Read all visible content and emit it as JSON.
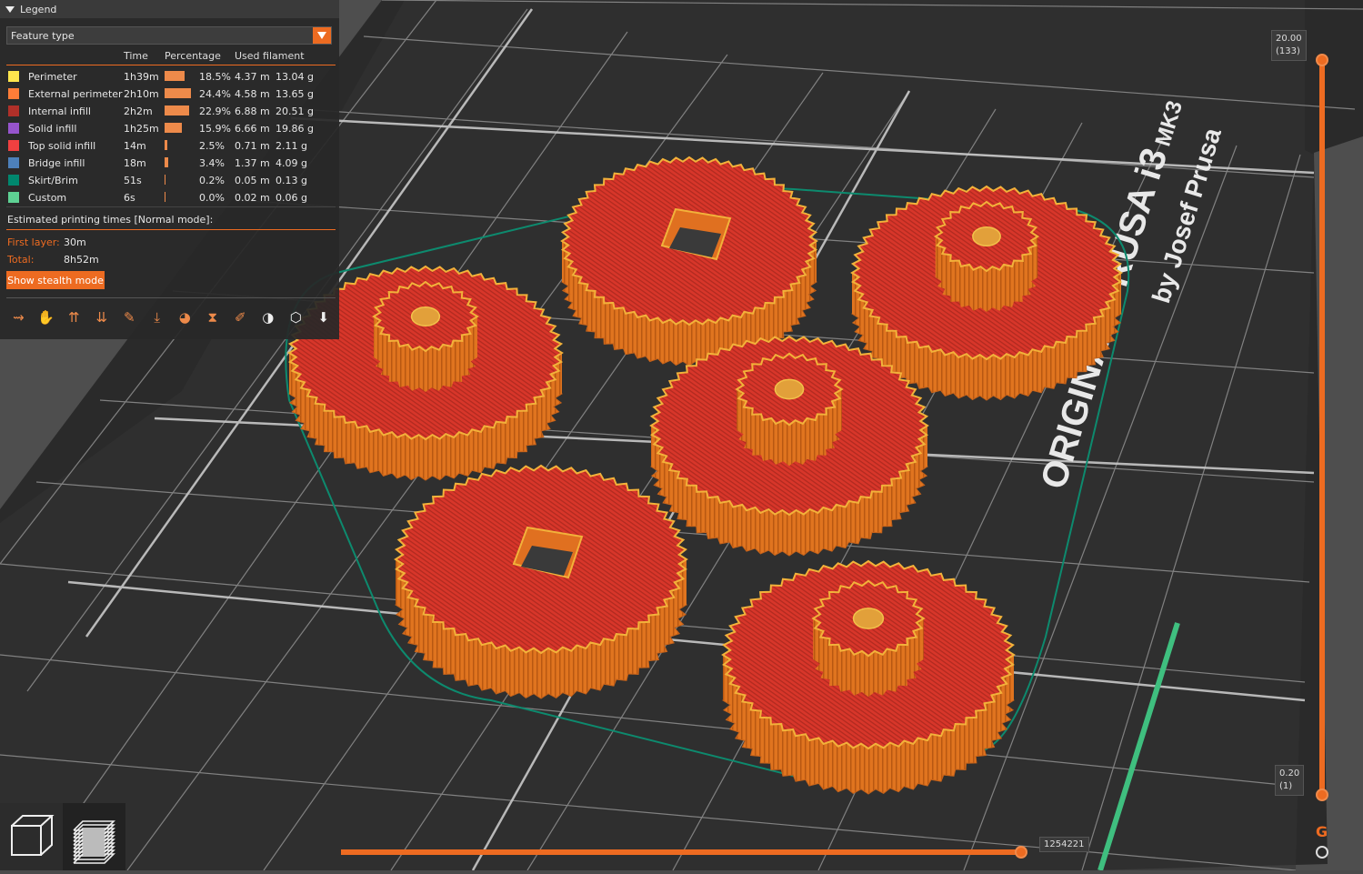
{
  "legend": {
    "title": "Legend",
    "view_type": "Feature type",
    "columns": {
      "time": "Time",
      "percentage": "Percentage",
      "filament": "Used filament"
    },
    "rows": [
      {
        "name": "Perimeter",
        "color": "#ffe64d",
        "time": "1h39m",
        "percent": "18.5%",
        "percent_value": 18.5,
        "length": "4.37 m",
        "weight": "13.04 g"
      },
      {
        "name": "External perimeter",
        "color": "#ff7d38",
        "time": "2h10m",
        "percent": "24.4%",
        "percent_value": 24.4,
        "length": "4.58 m",
        "weight": "13.65 g"
      },
      {
        "name": "Internal infill",
        "color": "#b03029",
        "time": "2h2m",
        "percent": "22.9%",
        "percent_value": 22.9,
        "length": "6.88 m",
        "weight": "20.51 g"
      },
      {
        "name": "Solid infill",
        "color": "#9654cc",
        "time": "1h25m",
        "percent": "15.9%",
        "percent_value": 15.9,
        "length": "6.66 m",
        "weight": "19.86 g"
      },
      {
        "name": "Top solid infill",
        "color": "#f04040",
        "time": "14m",
        "percent": "2.5%",
        "percent_value": 2.5,
        "length": "0.71 m",
        "weight": "2.11 g"
      },
      {
        "name": "Bridge infill",
        "color": "#4d80ba",
        "time": "18m",
        "percent": "3.4%",
        "percent_value": 3.4,
        "length": "1.37 m",
        "weight": "4.09 g"
      },
      {
        "name": "Skirt/Brim",
        "color": "#00876e",
        "time": "51s",
        "percent": "0.2%",
        "percent_value": 0.2,
        "length": "0.05 m",
        "weight": "0.13 g"
      },
      {
        "name": "Custom",
        "color": "#5ed194",
        "time": "6s",
        "percent": "0.0%",
        "percent_value": 0.0,
        "length": "0.02 m",
        "weight": "0.06 g"
      }
    ],
    "estimated_title": "Estimated printing times [Normal mode]:",
    "first_layer_label": "First layer:",
    "first_layer_value": "30m",
    "total_label": "Total:",
    "total_value": "8h52m",
    "stealth_button": "Show stealth mode",
    "toolbar_icons": [
      "travel-icon",
      "wipe-icon",
      "retractions-icon",
      "deretractions-icon",
      "seams-icon",
      "tool-changes-icon",
      "color-changes-icon",
      "pause-icon",
      "custom-gcode-icon",
      "cop-icon",
      "shells-icon",
      "tool-marker-icon"
    ]
  },
  "vertical_slider": {
    "top_value": "20.00",
    "top_layer": "(133)",
    "bottom_value": "0.20",
    "bottom_layer": "(1)"
  },
  "horizontal_slider": {
    "value": "1254221"
  },
  "bed_text": {
    "line1": "ORIGINAL PRUSA i3",
    "line1_suffix": "MK3",
    "line2": "by Josef Prusa"
  },
  "colors": {
    "accent": "#ed6b21",
    "infill": "#d8362a",
    "perimeter": "#e87a28",
    "bed": "#262626"
  }
}
